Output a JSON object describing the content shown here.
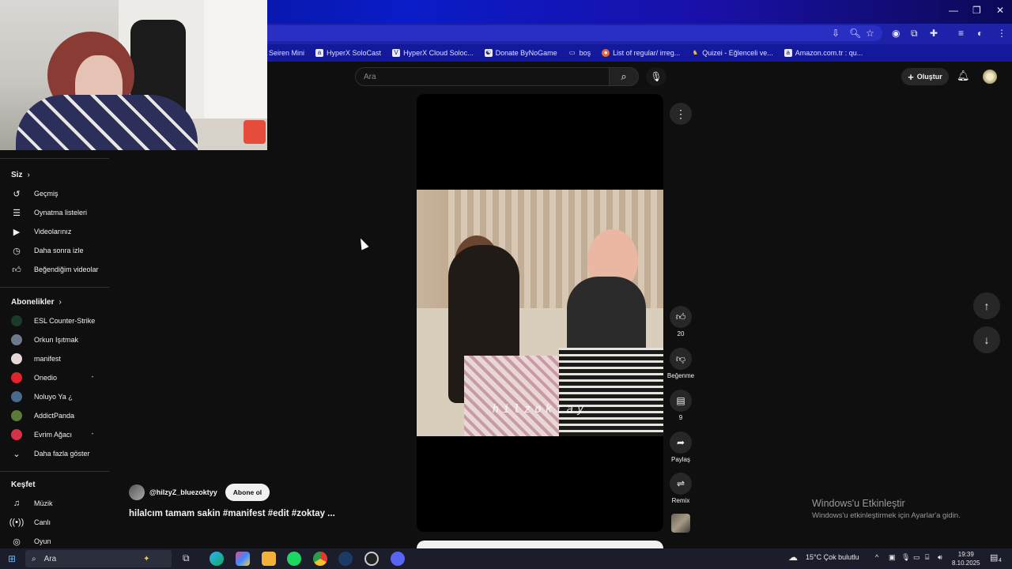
{
  "browser": {
    "bookmarks": [
      {
        "label": "Seiren Mini",
        "icon": ""
      },
      {
        "label": "HyperX SoloCast",
        "icon": "a"
      },
      {
        "label": "HyperX Cloud Soloc...",
        "icon": "V"
      },
      {
        "label": "Donate ByNoGame",
        "icon": "☯"
      },
      {
        "label": "boş",
        "icon": "▭"
      },
      {
        "label": "List of regular/ irreg...",
        "icon": "●"
      },
      {
        "label": "Quizei - Eğlenceli ve...",
        "icon": "♞"
      },
      {
        "label": "Amazon.com.tr : qu...",
        "icon": "a"
      }
    ]
  },
  "search": {
    "placeholder": "Ara"
  },
  "header": {
    "create_label": "Oluştur"
  },
  "sidebar": {
    "you_header": "Siz",
    "you_items": [
      {
        "label": "Geçmiş",
        "icon": "history-icon"
      },
      {
        "label": "Oynatma listeleri",
        "icon": "playlists-icon"
      },
      {
        "label": "Videolarınız",
        "icon": "your-videos-icon"
      },
      {
        "label": "Daha sonra izle",
        "icon": "watch-later-icon"
      },
      {
        "label": "Beğendiğim videolar",
        "icon": "liked-icon"
      }
    ],
    "subs_header": "Abonelikler",
    "subscriptions": [
      {
        "label": "ESL Counter-Strike",
        "color": "#1a3a2a"
      },
      {
        "label": "Orkun Işıtmak",
        "color": "#6d7a8c"
      },
      {
        "label": "manifest",
        "color": "#e8d7d7"
      },
      {
        "label": "Onedio",
        "color": "#e0242c"
      },
      {
        "label": "Noluyo Ya ¿",
        "color": "#4a6a8a"
      },
      {
        "label": "AddictPanda",
        "color": "#5c7a3a"
      },
      {
        "label": "Evrim Ağacı",
        "color": "#d8324a"
      }
    ],
    "show_more": "Daha fazla göster",
    "explore_header": "Keşfet",
    "explore_items": [
      {
        "label": "Müzik",
        "icon": "music-icon"
      },
      {
        "label": "Canlı",
        "icon": "live-icon"
      },
      {
        "label": "Oyun",
        "icon": "gaming-icon"
      }
    ]
  },
  "short": {
    "watermark": "hilzoktay",
    "channel": "@hilzyZ_bluezoktyy",
    "subscribe_label": "Abone ol",
    "title": "hilalcım tamam sakin #manifest #edit #zoktay ...",
    "likes": "20",
    "dislike_label": "Beğenme",
    "comments": "9",
    "share_label": "Paylaş",
    "remix_label": "Remix"
  },
  "windows": {
    "activate_title": "Windows'u Etkinleştir",
    "activate_sub": "Windows'u etkinleştirmek için Ayarlar'a gidin.",
    "search_label": "Ara",
    "weather": "15°C  Çok bulutlu",
    "time": "19:39",
    "date": "8.10.2025",
    "notif_count": "4"
  }
}
